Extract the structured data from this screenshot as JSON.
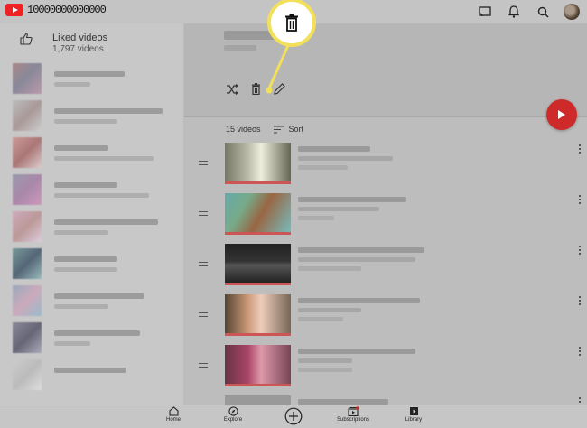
{
  "header": {
    "logo_text": "10000000000000",
    "icons": [
      "cast-icon",
      "bell-icon",
      "search-icon",
      "avatar"
    ]
  },
  "playlist": {
    "title": "Liked videos",
    "count_label": "1,797 videos"
  },
  "list_header": {
    "count_label": "15 videos",
    "sort_label": "Sort"
  },
  "actions": {
    "icons": [
      "shuffle-icon",
      "trash-icon",
      "edit-pencil-icon"
    ]
  },
  "bottom_nav": {
    "items": [
      {
        "label": "Home",
        "icon": "home-icon"
      },
      {
        "label": "Explore",
        "icon": "compass-icon"
      },
      {
        "label": "",
        "icon": "create-plus-icon"
      },
      {
        "label": "Subscriptions",
        "icon": "subscriptions-icon"
      },
      {
        "label": "Library",
        "icon": "library-icon"
      }
    ]
  },
  "colors": {
    "accent_red": "#cf2a2a",
    "callout_yellow": "#f3e05a"
  }
}
